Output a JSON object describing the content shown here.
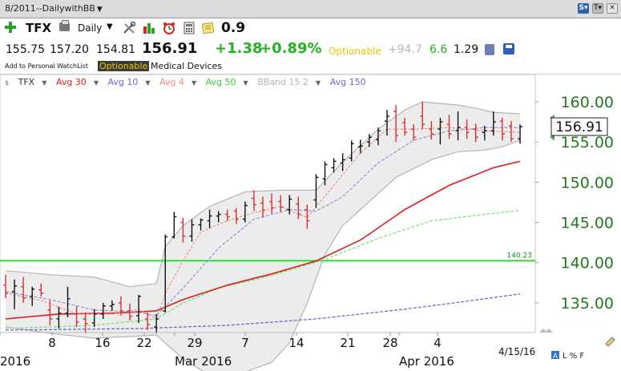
{
  "window": {
    "title": "8/2011--DailywithBB"
  },
  "toolbar": {
    "symbol": "TFX",
    "period": "Daily",
    "score": "0.9",
    "icons": [
      "add-watchlist-icon",
      "printer-icon",
      "tools-icon",
      "bar-chart-icon",
      "alarm-clock-icon",
      "calculator-icon",
      "note-icon"
    ]
  },
  "quote": {
    "open": "155.75",
    "high": "157.20",
    "low": "154.81",
    "last": "156.91",
    "change": "+1.38",
    "change_pct": "+0.89%",
    "optionable": "Optionable",
    "val1": "+94.7",
    "val2": "6.6",
    "val3": "1.29"
  },
  "info": {
    "watchlist_link": "Add to Personal WatchList",
    "optionable": "Optionable",
    "industry": "Medical Devices"
  },
  "colors": {
    "up_bar": "#111111",
    "down_bar": "#d83030",
    "avg30": "#dd1c1c",
    "avg10": "#8b8bdd",
    "avg4": "#f08a7a",
    "avg50": "#7ee07e",
    "avg150": "#6a6ad0",
    "band_fill": "#ececec",
    "band_line": "#b5b5b5",
    "hline": "#2edb2e",
    "axis_text": "#1f7a1f"
  },
  "chart_data": {
    "type": "ohlc",
    "legend": [
      {
        "label": "TFX",
        "color": "#333333"
      },
      {
        "label": "Avg 30",
        "color": "#dd1c1c"
      },
      {
        "label": "Avg 10",
        "color": "#6a6ad0"
      },
      {
        "label": "Avg 4",
        "color": "#f08a7a"
      },
      {
        "label": "Avg 50",
        "color": "#3ec83e"
      },
      {
        "label": "BBand 15 2",
        "color": "#b5b5b5"
      },
      {
        "label": "Avg 150",
        "color": "#6a6ad0"
      }
    ],
    "x_ticks": [
      "2016",
      "8",
      "16",
      "22",
      "29",
      "Mar 2016",
      "7",
      "14",
      "21",
      "28",
      "4",
      "Apr 2016"
    ],
    "date_label": "4/15/16",
    "corner_label": "L % F",
    "corner_box_label": "A",
    "ylim": [
      131.5,
      162
    ],
    "y_ticks": [
      "160.00",
      "155.00",
      "150.00",
      "145.00",
      "140.00",
      "135.00"
    ],
    "last_price_label": "156.91",
    "hline": {
      "value": 140.23,
      "label": "140.23"
    },
    "bars": [
      {
        "o": 137.2,
        "h": 138.5,
        "l": 135.6,
        "c": 136.2
      },
      {
        "o": 136.4,
        "h": 137.9,
        "l": 134.2,
        "c": 137.1
      },
      {
        "o": 137.0,
        "h": 138.2,
        "l": 135.0,
        "c": 135.6
      },
      {
        "o": 135.8,
        "h": 137.0,
        "l": 134.6,
        "c": 136.7
      },
      {
        "o": 136.6,
        "h": 137.4,
        "l": 135.8,
        "c": 136.2
      },
      {
        "o": 134.1,
        "h": 135.3,
        "l": 132.2,
        "c": 133.0
      },
      {
        "o": 133.0,
        "h": 134.5,
        "l": 131.8,
        "c": 133.7
      },
      {
        "o": 133.7,
        "h": 137.0,
        "l": 133.2,
        "c": 135.5
      },
      {
        "o": 133.6,
        "h": 134.6,
        "l": 132.0,
        "c": 132.6
      },
      {
        "o": 133.0,
        "h": 133.8,
        "l": 131.2,
        "c": 132.4
      },
      {
        "o": 132.5,
        "h": 134.2,
        "l": 132.0,
        "c": 133.6
      },
      {
        "o": 133.6,
        "h": 135.0,
        "l": 133.0,
        "c": 134.6
      },
      {
        "o": 134.6,
        "h": 135.3,
        "l": 134.0,
        "c": 134.8
      },
      {
        "o": 135.0,
        "h": 135.8,
        "l": 133.4,
        "c": 134.0
      },
      {
        "o": 134.0,
        "h": 134.9,
        "l": 132.8,
        "c": 133.3
      },
      {
        "o": 133.4,
        "h": 136.0,
        "l": 132.5,
        "c": 135.8
      },
      {
        "o": 133.0,
        "h": 133.8,
        "l": 131.6,
        "c": 132.3
      },
      {
        "o": 132.0,
        "h": 133.6,
        "l": 131.2,
        "c": 133.0
      },
      {
        "o": 134.0,
        "h": 143.5,
        "l": 133.8,
        "c": 143.2
      },
      {
        "o": 143.2,
        "h": 146.3,
        "l": 143.0,
        "c": 145.7
      },
      {
        "o": 145.0,
        "h": 145.6,
        "l": 142.5,
        "c": 143.3
      },
      {
        "o": 143.3,
        "h": 145.4,
        "l": 142.6,
        "c": 144.7
      },
      {
        "o": 144.7,
        "h": 145.5,
        "l": 144.0,
        "c": 145.3
      },
      {
        "o": 145.2,
        "h": 146.6,
        "l": 144.3,
        "c": 145.8
      },
      {
        "o": 145.8,
        "h": 146.4,
        "l": 145.0,
        "c": 146.0
      },
      {
        "o": 146.0,
        "h": 146.6,
        "l": 145.2,
        "c": 145.7
      },
      {
        "o": 146.4,
        "h": 146.8,
        "l": 144.8,
        "c": 145.4
      },
      {
        "o": 145.4,
        "h": 147.6,
        "l": 145.0,
        "c": 147.1
      },
      {
        "o": 148.0,
        "h": 149.0,
        "l": 146.4,
        "c": 147.2
      },
      {
        "o": 147.4,
        "h": 148.2,
        "l": 145.6,
        "c": 146.5
      },
      {
        "o": 147.6,
        "h": 148.6,
        "l": 146.1,
        "c": 146.8
      },
      {
        "o": 147.6,
        "h": 148.4,
        "l": 146.3,
        "c": 146.9
      },
      {
        "o": 146.6,
        "h": 148.4,
        "l": 146.0,
        "c": 147.9
      },
      {
        "o": 147.3,
        "h": 148.2,
        "l": 145.4,
        "c": 146.0
      },
      {
        "o": 146.6,
        "h": 147.2,
        "l": 144.2,
        "c": 145.2
      },
      {
        "o": 147.8,
        "h": 151.0,
        "l": 146.8,
        "c": 150.6
      },
      {
        "o": 150.4,
        "h": 152.6,
        "l": 149.6,
        "c": 152.2
      },
      {
        "o": 151.8,
        "h": 153.0,
        "l": 151.2,
        "c": 152.6
      },
      {
        "o": 152.4,
        "h": 153.6,
        "l": 151.4,
        "c": 152.8
      },
      {
        "o": 153.0,
        "h": 155.2,
        "l": 152.6,
        "c": 154.8
      },
      {
        "o": 154.4,
        "h": 155.3,
        "l": 153.6,
        "c": 154.5
      },
      {
        "o": 155.0,
        "h": 156.0,
        "l": 154.4,
        "c": 155.6
      },
      {
        "o": 155.3,
        "h": 156.8,
        "l": 154.6,
        "c": 156.4
      },
      {
        "o": 157.6,
        "h": 159.0,
        "l": 155.8,
        "c": 158.2
      },
      {
        "o": 158.8,
        "h": 159.6,
        "l": 155.0,
        "c": 155.8
      },
      {
        "o": 157.4,
        "h": 158.0,
        "l": 155.8,
        "c": 156.2
      },
      {
        "o": 156.6,
        "h": 157.2,
        "l": 155.2,
        "c": 155.6
      },
      {
        "o": 158.2,
        "h": 160.0,
        "l": 156.6,
        "c": 157.2
      },
      {
        "o": 156.6,
        "h": 157.6,
        "l": 155.3,
        "c": 156.0
      },
      {
        "o": 156.6,
        "h": 158.0,
        "l": 154.7,
        "c": 157.5
      },
      {
        "o": 157.2,
        "h": 158.4,
        "l": 155.4,
        "c": 156.0
      },
      {
        "o": 156.4,
        "h": 158.8,
        "l": 155.2,
        "c": 156.8
      },
      {
        "o": 156.8,
        "h": 157.8,
        "l": 155.4,
        "c": 156.2
      },
      {
        "o": 156.6,
        "h": 157.3,
        "l": 155.0,
        "c": 155.6
      },
      {
        "o": 156.2,
        "h": 157.0,
        "l": 155.2,
        "c": 156.4
      },
      {
        "o": 156.4,
        "h": 158.8,
        "l": 155.8,
        "c": 157.5
      },
      {
        "o": 157.6,
        "h": 158.0,
        "l": 155.2,
        "c": 156.0
      },
      {
        "o": 157.0,
        "h": 157.6,
        "l": 155.0,
        "c": 155.4
      },
      {
        "o": 155.4,
        "h": 157.2,
        "l": 154.8,
        "c": 156.9
      }
    ],
    "avg30": [
      [
        0,
        133.0
      ],
      [
        6,
        133.6
      ],
      [
        12,
        133.7
      ],
      [
        17,
        134.0
      ],
      [
        20,
        135.4
      ],
      [
        25,
        137.2
      ],
      [
        30,
        138.6
      ],
      [
        35,
        140.2
      ],
      [
        40,
        142.8
      ],
      [
        45,
        146.6
      ],
      [
        50,
        149.6
      ],
      [
        55,
        151.8
      ],
      [
        58,
        152.6
      ]
    ],
    "avg10": [
      [
        0,
        136.4
      ],
      [
        5,
        135.4
      ],
      [
        10,
        134.1
      ],
      [
        15,
        133.8
      ],
      [
        17,
        133.4
      ],
      [
        20,
        136.8
      ],
      [
        24,
        141.8
      ],
      [
        28,
        145.4
      ],
      [
        32,
        146.6
      ],
      [
        35,
        146.4
      ],
      [
        38,
        148.2
      ],
      [
        42,
        152.4
      ],
      [
        46,
        155.2
      ],
      [
        50,
        156.4
      ],
      [
        54,
        156.8
      ],
      [
        58,
        156.8
      ]
    ],
    "avg4": [
      [
        0,
        136.2
      ],
      [
        4,
        135.3
      ],
      [
        8,
        133.6
      ],
      [
        12,
        133.6
      ],
      [
        15,
        134.2
      ],
      [
        17,
        133.0
      ],
      [
        18,
        136.2
      ],
      [
        20,
        140.2
      ],
      [
        22,
        143.8
      ],
      [
        25,
        145.2
      ],
      [
        28,
        146.2
      ],
      [
        31,
        147.0
      ],
      [
        34,
        145.6
      ],
      [
        37,
        149.6
      ],
      [
        40,
        153.6
      ],
      [
        43,
        156.6
      ],
      [
        46,
        156.6
      ],
      [
        50,
        156.8
      ],
      [
        54,
        156.4
      ],
      [
        58,
        156.2
      ]
    ],
    "avg50": [
      [
        0,
        131.8
      ],
      [
        10,
        132.2
      ],
      [
        17,
        133.0
      ],
      [
        20,
        135.0
      ],
      [
        24,
        136.8
      ],
      [
        30,
        138.4
      ],
      [
        36,
        140.4
      ],
      [
        42,
        143.0
      ],
      [
        48,
        145.2
      ],
      [
        54,
        146.0
      ],
      [
        58,
        146.5
      ]
    ],
    "avg150": [
      [
        0,
        131.6
      ],
      [
        15,
        131.8
      ],
      [
        25,
        132.2
      ],
      [
        35,
        133.0
      ],
      [
        45,
        134.2
      ],
      [
        52,
        135.2
      ],
      [
        58,
        136.1
      ]
    ],
    "bband_upper": [
      [
        0,
        139.0
      ],
      [
        5,
        138.5
      ],
      [
        10,
        138.2
      ],
      [
        14,
        137.0
      ],
      [
        17,
        137.4
      ],
      [
        18,
        142.0
      ],
      [
        20,
        144.6
      ],
      [
        23,
        147.0
      ],
      [
        27,
        148.8
      ],
      [
        31,
        149.0
      ],
      [
        35,
        149.0
      ],
      [
        38,
        152.5
      ],
      [
        42,
        156.6
      ],
      [
        45,
        159.0
      ],
      [
        47,
        160.0
      ],
      [
        51,
        159.6
      ],
      [
        53,
        159.2
      ],
      [
        55,
        158.7
      ],
      [
        58,
        158.5
      ]
    ],
    "bband_lower": [
      [
        0,
        132.0
      ],
      [
        5,
        131.2
      ],
      [
        10,
        130.6
      ],
      [
        14,
        130.8
      ],
      [
        17,
        131.0
      ],
      [
        20,
        128.0
      ],
      [
        23,
        126.0
      ],
      [
        27,
        126.4
      ],
      [
        30,
        127.6
      ],
      [
        32,
        130.0
      ],
      [
        34,
        135.0
      ],
      [
        36,
        141.0
      ],
      [
        38,
        144.6
      ],
      [
        41,
        147.6
      ],
      [
        44,
        150.6
      ],
      [
        48,
        152.8
      ],
      [
        51,
        153.8
      ],
      [
        54,
        154.0
      ],
      [
        56,
        154.4
      ],
      [
        58,
        155.2
      ]
    ]
  }
}
